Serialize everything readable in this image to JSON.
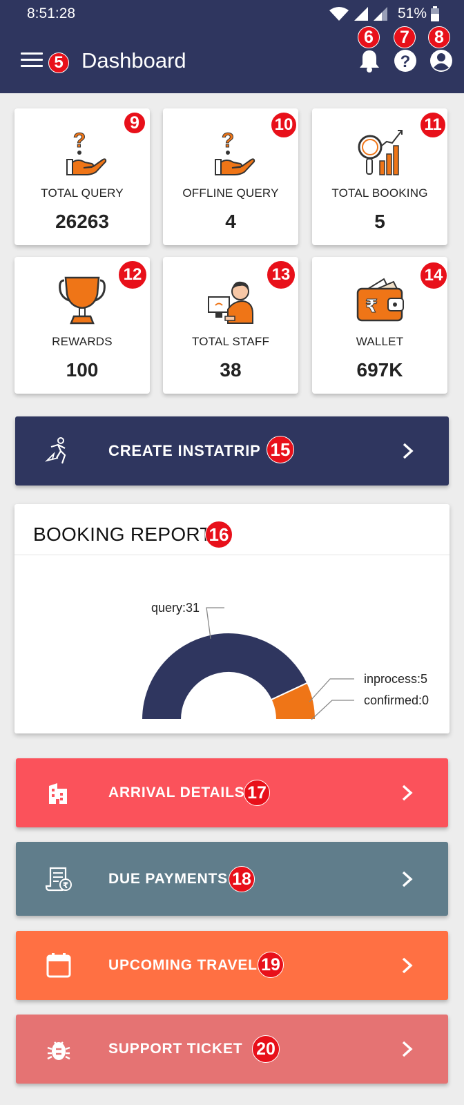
{
  "status_bar": {
    "time": "8:51:28",
    "battery": "51%"
  },
  "app_bar": {
    "title": "Dashboard"
  },
  "annotations": [
    "5",
    "6",
    "7",
    "8",
    "9",
    "10",
    "11",
    "12",
    "13",
    "14",
    "15",
    "16",
    "17",
    "18",
    "19",
    "20"
  ],
  "stats": [
    {
      "label": "TOTAL QUERY",
      "value": "26263",
      "icon": "query-hand-icon"
    },
    {
      "label": "OFFLINE QUERY",
      "value": "4",
      "icon": "query-hand-icon"
    },
    {
      "label": "TOTAL BOOKING",
      "value": "5",
      "icon": "growth-chart-icon"
    },
    {
      "label": "REWARDS",
      "value": "100",
      "icon": "trophy-icon"
    },
    {
      "label": "TOTAL STAFF",
      "value": "38",
      "icon": "staff-icon"
    },
    {
      "label": "WALLET",
      "value": "697K",
      "icon": "wallet-icon"
    }
  ],
  "instatrip": {
    "label": "CREATE INSTATRIP",
    "color": "#2f365f"
  },
  "report": {
    "title": "BOOKING REPORT"
  },
  "chart_data": {
    "type": "pie",
    "variant": "half-donut",
    "categories": [
      "query",
      "inprocess",
      "confirmed"
    ],
    "values": [
      31,
      5,
      0
    ],
    "labels": [
      "query:31",
      "inprocess:5",
      "confirmed:0"
    ],
    "colors": [
      "#2f365f",
      "#ef7517",
      "#ef7517"
    ]
  },
  "actions": [
    {
      "label": "ARRIVAL DETAILS",
      "color": "#fb525b",
      "icon": "building-icon"
    },
    {
      "label": "DUE PAYMENTS",
      "color": "#607d8b",
      "icon": "receipt-icon"
    },
    {
      "label": "UPCOMING TRAVEL",
      "color": "#ff7043",
      "icon": "calendar-icon"
    },
    {
      "label": "SUPPORT TICKET",
      "color": "#e57373",
      "icon": "bug-icon"
    }
  ]
}
